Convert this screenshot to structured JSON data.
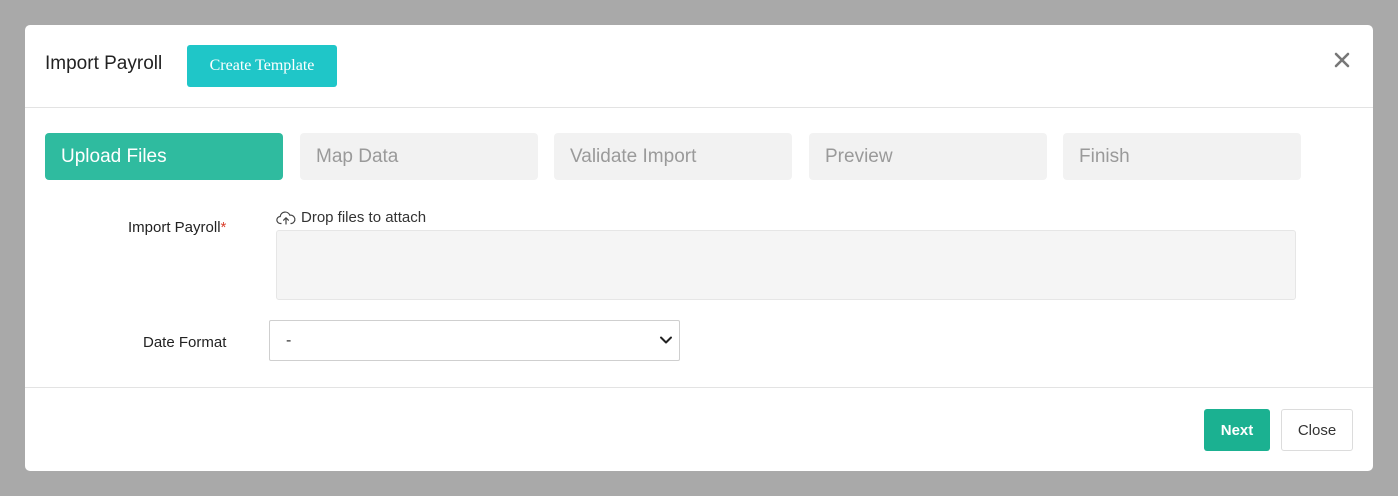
{
  "header": {
    "title": "Import Payroll",
    "create_template_label": "Create Template",
    "close_icon": "close-icon"
  },
  "steps": [
    {
      "label": "Upload Files",
      "active": true
    },
    {
      "label": "Map Data",
      "active": false
    },
    {
      "label": "Validate Import",
      "active": false
    },
    {
      "label": "Preview",
      "active": false
    },
    {
      "label": "Finish",
      "active": false
    }
  ],
  "form": {
    "import_label": "Import Payroll",
    "required_mark": "*",
    "drop_text": "Drop files to attach",
    "drop_icon": "cloud-upload-icon",
    "date_format_label": "Date Format",
    "date_format_value": "-"
  },
  "footer": {
    "next_label": "Next",
    "close_label": "Close"
  },
  "colors": {
    "accent_teal": "#1fc6c8",
    "active_step": "#2fbb9f",
    "next_button": "#1bb191",
    "required": "#d93f2c"
  }
}
